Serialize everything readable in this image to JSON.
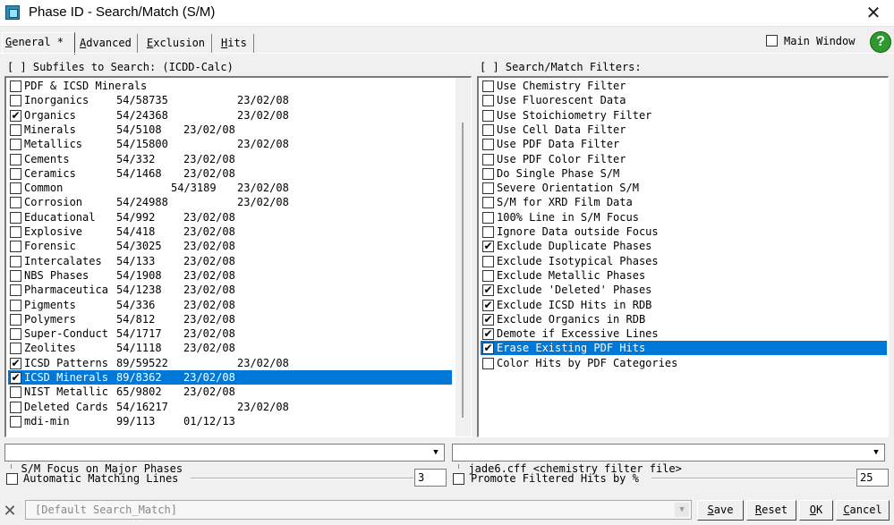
{
  "window": {
    "title": "Phase ID - Search/Match (S/M)",
    "close_glyph": "✕"
  },
  "tabs": [
    {
      "label": "General *",
      "hotkey": "G",
      "rest": "eneral *",
      "active": true
    },
    {
      "label": "Advanced",
      "hotkey": "A",
      "rest": "dvanced",
      "active": false
    },
    {
      "label": "Exclusion",
      "hotkey": "E",
      "rest": "xclusion",
      "active": false
    },
    {
      "label": "Hits",
      "hotkey": "H",
      "rest": "its",
      "active": false
    }
  ],
  "header": {
    "main_window_label": "Main Window",
    "help_glyph": "?"
  },
  "subfiles": {
    "label": "[ ] Subfiles to Search: (ICDD-Calc)",
    "items": [
      {
        "name": "PDF & ICSD Minerals",
        "count": "",
        "date": "",
        "checked": false,
        "selected": false,
        "pad": 0
      },
      {
        "name": "Inorganics",
        "count": "54/58735",
        "date": "23/02/08",
        "checked": false,
        "selected": false,
        "pad": 1
      },
      {
        "name": "Organics",
        "count": "54/24368",
        "date": "23/02/08",
        "checked": true,
        "selected": false,
        "pad": 1
      },
      {
        "name": "Minerals",
        "count": "54/5108",
        "date": "23/02/08",
        "checked": false,
        "selected": false,
        "pad": 0
      },
      {
        "name": "Metallics",
        "count": "54/15800",
        "date": "23/02/08",
        "checked": false,
        "selected": false,
        "pad": 1
      },
      {
        "name": "Cements",
        "count": "54/332",
        "date": "23/02/08",
        "checked": false,
        "selected": false,
        "pad": 0
      },
      {
        "name": "Ceramics",
        "count": "54/1468",
        "date": "23/02/08",
        "checked": false,
        "selected": false,
        "pad": 0
      },
      {
        "name": "Common",
        "count": "54/3189",
        "date": "23/02/08",
        "checked": false,
        "selected": false,
        "pad": 2
      },
      {
        "name": "Corrosion",
        "count": "54/24988",
        "date": "23/02/08",
        "checked": false,
        "selected": false,
        "pad": 1
      },
      {
        "name": "Educational",
        "count": "54/992",
        "date": "23/02/08",
        "checked": false,
        "selected": false,
        "pad": 0
      },
      {
        "name": "Explosive",
        "count": "54/418",
        "date": "23/02/08",
        "checked": false,
        "selected": false,
        "pad": 0
      },
      {
        "name": "Forensic",
        "count": "54/3025",
        "date": "23/02/08",
        "checked": false,
        "selected": false,
        "pad": 0
      },
      {
        "name": "Intercalates",
        "count": "54/133",
        "date": "23/02/08",
        "checked": false,
        "selected": false,
        "pad": 0
      },
      {
        "name": "NBS Phases",
        "count": "54/1908",
        "date": "23/02/08",
        "checked": false,
        "selected": false,
        "pad": 0
      },
      {
        "name": "Pharmaceutica",
        "count": "54/1238",
        "date": "23/02/08",
        "checked": false,
        "selected": false,
        "pad": 0
      },
      {
        "name": "Pigments",
        "count": "54/336",
        "date": "23/02/08",
        "checked": false,
        "selected": false,
        "pad": 0
      },
      {
        "name": "Polymers",
        "count": "54/812",
        "date": "23/02/08",
        "checked": false,
        "selected": false,
        "pad": 0
      },
      {
        "name": "Super-Conduct",
        "count": "54/1717",
        "date": "23/02/08",
        "checked": false,
        "selected": false,
        "pad": 0
      },
      {
        "name": "Zeolites",
        "count": "54/1118",
        "date": "23/02/08",
        "checked": false,
        "selected": false,
        "pad": 0
      },
      {
        "name": "ICSD Patterns",
        "count": "89/59522",
        "date": "23/02/08",
        "checked": true,
        "selected": false,
        "pad": 1
      },
      {
        "name": "ICSD Minerals",
        "count": "89/8362",
        "date": "23/02/08",
        "checked": true,
        "selected": true,
        "pad": 0
      },
      {
        "name": "NIST Metallic",
        "count": "65/9802",
        "date": "23/02/08",
        "checked": false,
        "selected": false,
        "pad": 0
      },
      {
        "name": "Deleted Cards",
        "count": "54/16217",
        "date": "23/02/08",
        "checked": false,
        "selected": false,
        "pad": 1
      },
      {
        "name": "mdi-min",
        "count": "99/113",
        "date": "01/12/13",
        "checked": false,
        "selected": false,
        "pad": 0
      }
    ]
  },
  "filters": {
    "label": "[ ] Search/Match Filters:",
    "items": [
      {
        "label": "Use Chemistry Filter",
        "checked": false,
        "selected": false
      },
      {
        "label": "Use Fluorescent Data",
        "checked": false,
        "selected": false
      },
      {
        "label": "Use Stoichiometry Filter",
        "checked": false,
        "selected": false
      },
      {
        "label": "Use Cell Data Filter",
        "checked": false,
        "selected": false
      },
      {
        "label": "Use PDF Data Filter",
        "checked": false,
        "selected": false
      },
      {
        "label": "Use PDF Color Filter",
        "checked": false,
        "selected": false
      },
      {
        "label": "Do Single Phase S/M",
        "checked": false,
        "selected": false
      },
      {
        "label": "Severe Orientation S/M",
        "checked": false,
        "selected": false
      },
      {
        "label": "S/M for XRD Film Data",
        "checked": false,
        "selected": false
      },
      {
        "label": "100% Line in S/M Focus",
        "checked": false,
        "selected": false
      },
      {
        "label": "Ignore Data outside Focus",
        "checked": false,
        "selected": false
      },
      {
        "label": "Exclude Duplicate Phases",
        "checked": true,
        "selected": false
      },
      {
        "label": "Exclude Isotypical Phases",
        "checked": false,
        "selected": false
      },
      {
        "label": "Exclude Metallic Phases",
        "checked": false,
        "selected": false
      },
      {
        "label": "Exclude 'Deleted' Phases",
        "checked": true,
        "selected": false
      },
      {
        "label": "Exclude ICSD Hits in RDB",
        "checked": true,
        "selected": false
      },
      {
        "label": "Exclude Organics in RDB",
        "checked": true,
        "selected": false
      },
      {
        "label": "Demote if Excessive Lines",
        "checked": true,
        "selected": false
      },
      {
        "label": "Erase Existing PDF Hits",
        "checked": true,
        "selected": true
      },
      {
        "label": "Color Hits by PDF Categories",
        "checked": false,
        "selected": false
      }
    ]
  },
  "focus_combo": {
    "value": "S/M Focus on Major Phases"
  },
  "chem_combo": {
    "value": "jade6.cff <chemistry filter file>"
  },
  "auto_lines": {
    "label": "Automatic Matching Lines",
    "value": "3"
  },
  "promote_hits": {
    "label": "Promote Filtered Hits by %",
    "value": "25"
  },
  "bottom": {
    "close_glyph": "✕",
    "preset_value": "[Default Search_Match]",
    "buttons": [
      {
        "label": "Save",
        "hotkey": "S",
        "rest": "ave"
      },
      {
        "label": "Reset",
        "hotkey": "R",
        "rest": "eset"
      },
      {
        "label": "OK",
        "hotkey": "O",
        "rest": "K"
      },
      {
        "label": "Cancel",
        "hotkey": "C",
        "rest": "ancel"
      }
    ]
  },
  "colors": {
    "selection": "#0078d7",
    "help": "#2e9a2e"
  }
}
